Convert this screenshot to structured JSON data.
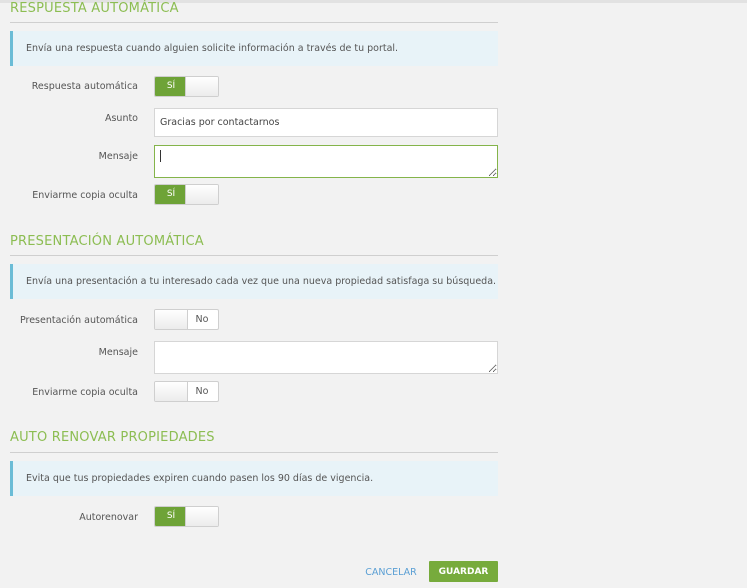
{
  "respuesta": {
    "title": "RESPUESTA AUTOMÁTICA",
    "info": "Envía una respuesta cuando alguien solicite información a través de tu portal.",
    "toggle_label": "Respuesta automática",
    "toggle_state": "SÍ",
    "asunto_label": "Asunto",
    "asunto_value": "Gracias por contactarnos",
    "mensaje_label": "Mensaje",
    "mensaje_value": "",
    "copia_label": "Enviarme copia oculta",
    "copia_state": "SÍ"
  },
  "presentacion": {
    "title": "PRESENTACIÓN AUTOMÁTICA",
    "info": "Envía una presentación a tu interesado cada vez que una nueva propiedad satisfaga su búsqueda.",
    "toggle_label": "Presentación automática",
    "toggle_state": "No",
    "mensaje_label": "Mensaje",
    "mensaje_value": "",
    "copia_label": "Enviarme copia oculta",
    "copia_state": "No"
  },
  "renovar": {
    "title": "AUTO RENOVAR PROPIEDADES",
    "info": "Evita que tus propiedades expiren cuando pasen los 90 días de vigencia.",
    "toggle_label": "Autorenovar",
    "toggle_state": "SÍ"
  },
  "actions": {
    "cancel_label": "CANCELAR",
    "save_label": "GUARDAR"
  },
  "colors": {
    "accent_green": "#77ab3c",
    "title_green": "#8cbd52",
    "info_border": "#6bbcd6",
    "link_blue": "#5a9fd4"
  }
}
